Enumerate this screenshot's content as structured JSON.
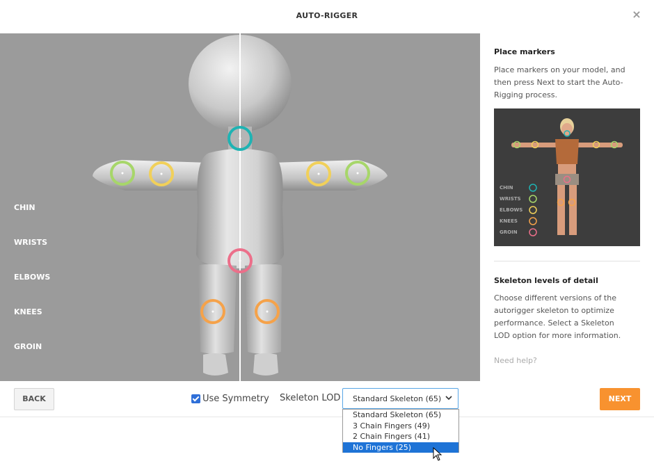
{
  "header": {
    "title": "AUTO-RIGGER",
    "close_label": "×"
  },
  "viewport": {
    "legend": [
      "CHIN",
      "WRISTS",
      "ELBOWS",
      "KNEES",
      "GROIN"
    ],
    "marker_colors": {
      "chin": "#1fb3b3",
      "wrists": "#a7d66a",
      "elbows": "#f1d05a",
      "knees": "#f5a24a",
      "groin": "#ec6f8a"
    }
  },
  "panel": {
    "place_title": "Place markers",
    "place_text": "Place markers on your model, and then press Next to start the Auto-Rigging process.",
    "thumb_labels": [
      "CHIN",
      "WRISTS",
      "ELBOWS",
      "KNEES",
      "GROIN"
    ],
    "lod_title": "Skeleton levels of detail",
    "lod_text": "Choose different versions of the autorigger skeleton to optimize performance. Select a Skeleton LOD option for more information.",
    "help": "Need help?"
  },
  "footer": {
    "back": "BACK",
    "next": "NEXT",
    "symmetry_label": "Use Symmetry",
    "symmetry_checked": true,
    "lod_label": "Skeleton LOD",
    "lod_value": "Standard Skeleton (65)",
    "lod_options": [
      "Standard Skeleton (65)",
      "3 Chain Fingers (49)",
      "2 Chain Fingers (41)",
      "No Fingers (25)"
    ],
    "lod_highlighted": "No Fingers (25)"
  },
  "colors": {
    "accent": "#f8922f",
    "select_border": "#58a6e6",
    "highlight": "#1e73d6",
    "viewport_bg": "#9b9b9b"
  }
}
